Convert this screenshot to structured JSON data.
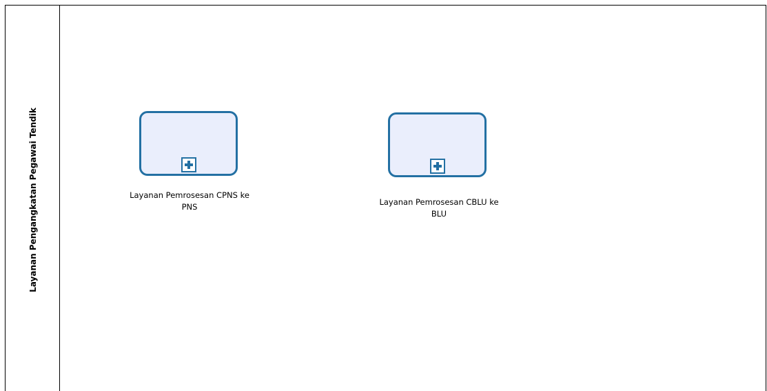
{
  "lane": {
    "title": "Layanan Pengangkatan Pegawai Tendik"
  },
  "tasks": [
    {
      "label_line1": "Layanan Pemrosesan CPNS ke",
      "label_line2": "PNS",
      "icon": "subprocess-plus-icon"
    },
    {
      "label_line1": "Layanan Pemrosesan CBLU ke",
      "label_line2": "BLU",
      "icon": "subprocess-plus-icon"
    }
  ],
  "colors": {
    "task_fill": "#eaeefc",
    "task_border": "#2370a3",
    "lane_border": "#000000"
  }
}
